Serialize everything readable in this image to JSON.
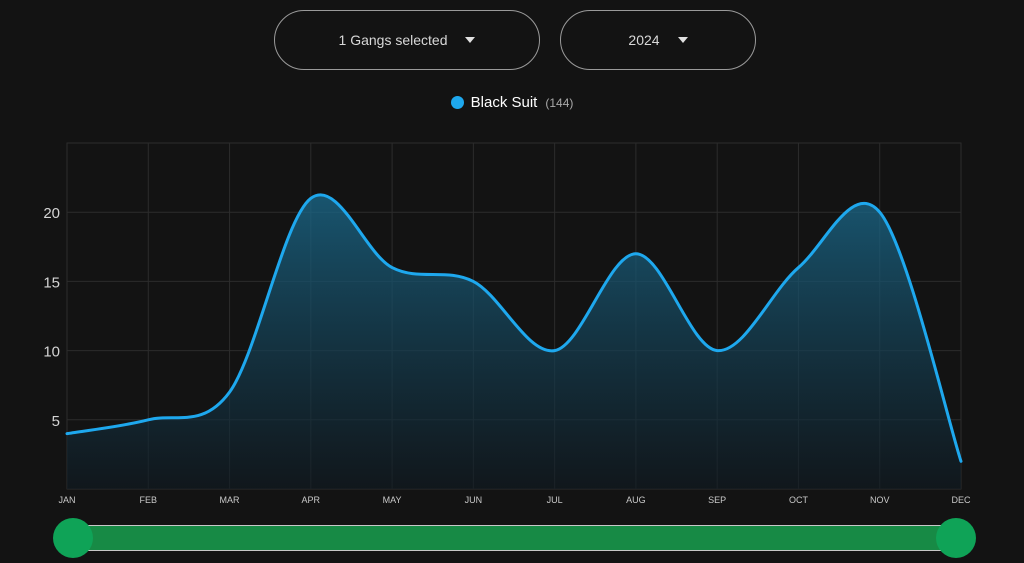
{
  "filters": {
    "gangs_label": "1 Gangs selected",
    "year_label": "2024"
  },
  "legend": {
    "name": "Black Suit",
    "count": "(144)",
    "color": "#1ea8ee"
  },
  "chart_data": {
    "type": "area",
    "categories": [
      "JAN",
      "FEB",
      "MAR",
      "APR",
      "MAY",
      "JUN",
      "JUL",
      "AUG",
      "SEP",
      "OCT",
      "NOV",
      "DEC"
    ],
    "series": [
      {
        "name": "Black Suit",
        "values": [
          4,
          5,
          7,
          21,
          16,
          15,
          10,
          17,
          10,
          16,
          20,
          2
        ],
        "color": "#1ea8ee"
      }
    ],
    "y_ticks": [
      "5",
      "10",
      "15",
      "20"
    ],
    "ylim": [
      0,
      25
    ],
    "grid": true,
    "legend_position": "top-center"
  },
  "slider": {
    "track_color": "#178a45",
    "handle_color": "#0fa357"
  }
}
